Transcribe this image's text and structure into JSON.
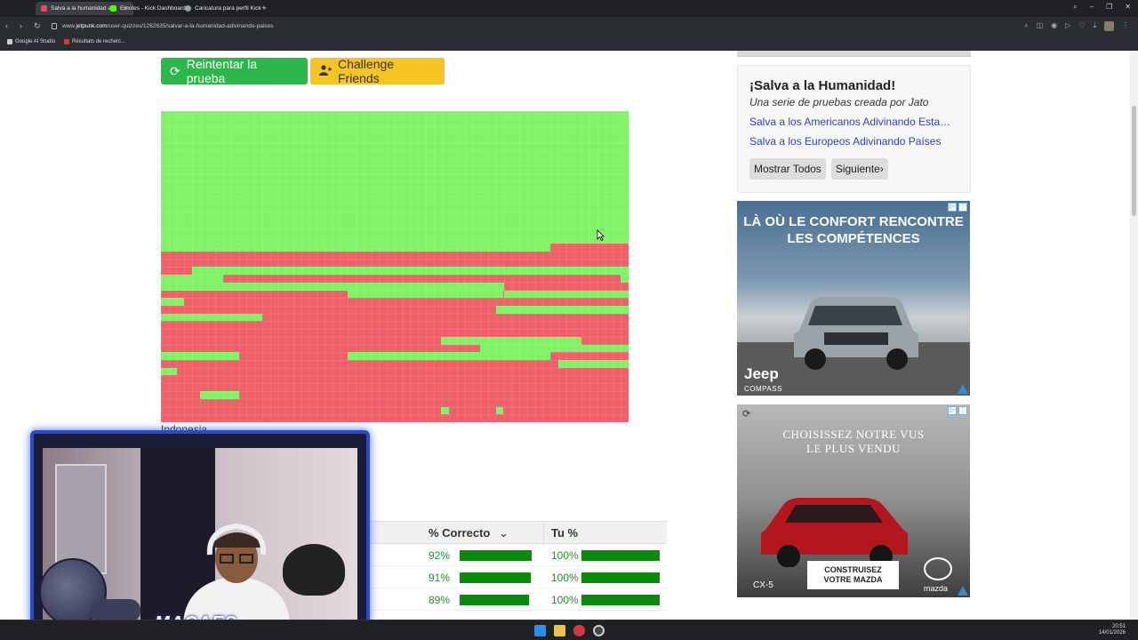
{
  "browser": {
    "tabs": [
      {
        "label": "Salva a la humanidad adi",
        "active": true
      },
      {
        "label": "Emotes - Kick Dashboard",
        "active": false
      },
      {
        "label": "Caricatura para perfil Kick",
        "active": false
      }
    ],
    "url": {
      "prefix": "www.",
      "domain": "jetpunk.com",
      "path": "/user-quizzes/1262635/salvar-a-la-humanidad-adivinando-paises"
    },
    "bookmarks": [
      "Google AI Studio",
      "Résultats de recherc..."
    ]
  },
  "actions": {
    "retry_label": "Reintentar la prueba",
    "challenge_label": "Challenge Friends"
  },
  "map": {
    "caption": "Indonesia",
    "colors": {
      "correct": "#80f266",
      "missed": "#f0606b"
    }
  },
  "stats_table": {
    "headers": [
      "% Correcto",
      "Tu %"
    ],
    "rows": [
      {
        "correct_pct": "92%",
        "correct_value": 92,
        "your_pct": "100%",
        "your_value": 100
      },
      {
        "correct_pct": "91%",
        "correct_value": 91,
        "your_pct": "100%",
        "your_value": 100
      },
      {
        "correct_pct": "89%",
        "correct_value": 89,
        "your_pct": "100%",
        "your_value": 100
      }
    ]
  },
  "series": {
    "title": "¡Salva a la Humanidad!",
    "subtitle": "Una serie de pruebas creada por Jato",
    "links": [
      "Salva a los Americanos Adivinando Esta…",
      "Salva a los Europeos Adivinando Países"
    ],
    "show_all_label": "Mostrar Todos",
    "next_label": "Siguiente"
  },
  "ads": {
    "jeep": {
      "headline_1": "LÀ OÙ LE CONFORT RENCONTRE",
      "headline_2": "LES COMPÉTENCES",
      "brand": "Jeep",
      "model": "COMPASS"
    },
    "mazda": {
      "headline_1": "CHOISISSEZ NOTRE VUS",
      "headline_2": "LE PLUS VENDU",
      "cta_1": "CONSTRUISEZ",
      "cta_2": "VOTRE MAZDA",
      "model": "CX-5",
      "brand": "mazda"
    }
  },
  "stream": {
    "name": "MACAES"
  },
  "taskbar": {
    "time": "20:51",
    "date": "14/01/2026"
  }
}
